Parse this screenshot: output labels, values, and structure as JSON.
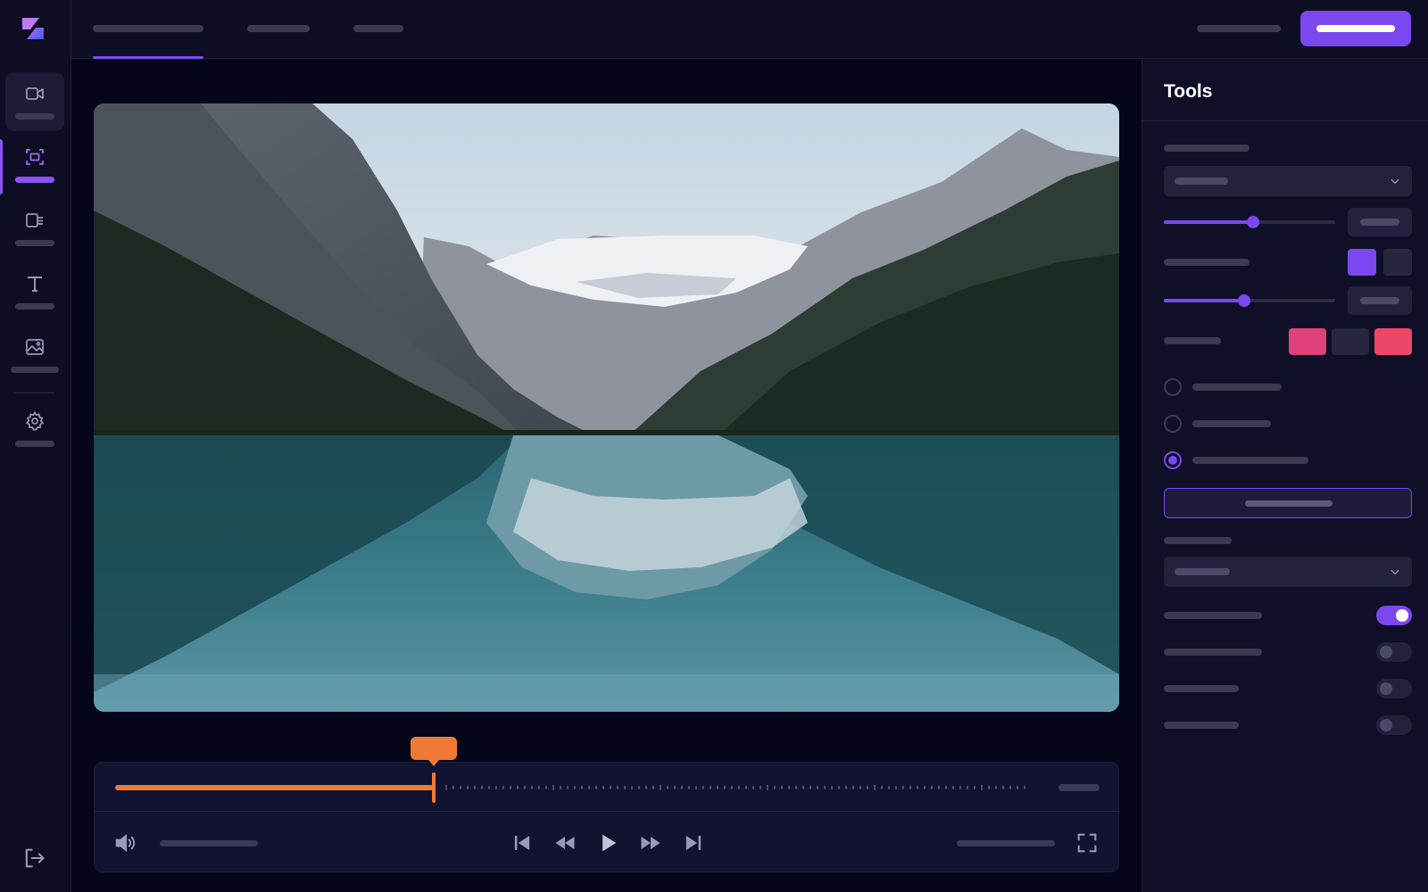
{
  "tools_panel": {
    "title": "Tools"
  },
  "timeline": {
    "progress": 0.35
  },
  "controls": {
    "slider_1": {
      "value": 0.52
    },
    "slider_2": {
      "value": 0.47
    },
    "radio_options": [
      {
        "selected": false
      },
      {
        "selected": false
      },
      {
        "selected": true
      }
    ],
    "toggles": [
      {
        "on": true
      },
      {
        "on": false
      },
      {
        "on": false
      },
      {
        "on": false
      }
    ],
    "swatches_1": [
      "#7b47ee",
      "#26263f"
    ],
    "swatches_2": [
      "#e0417a",
      "#26263f",
      "#ec4668"
    ]
  },
  "icons": {
    "rail": [
      "video-camera-icon",
      "crop-frame-icon",
      "media-list-icon",
      "text-icon",
      "image-icon",
      "gear-icon"
    ],
    "exit": "logout-icon",
    "player": [
      "volume-icon",
      "skip-back-icon",
      "rewind-icon",
      "play-icon",
      "fast-forward-icon",
      "skip-forward-icon",
      "fullscreen-icon"
    ]
  },
  "colors": {
    "accent": "#7b47ee",
    "timeline": "#f07a34",
    "background": "#06061a"
  }
}
